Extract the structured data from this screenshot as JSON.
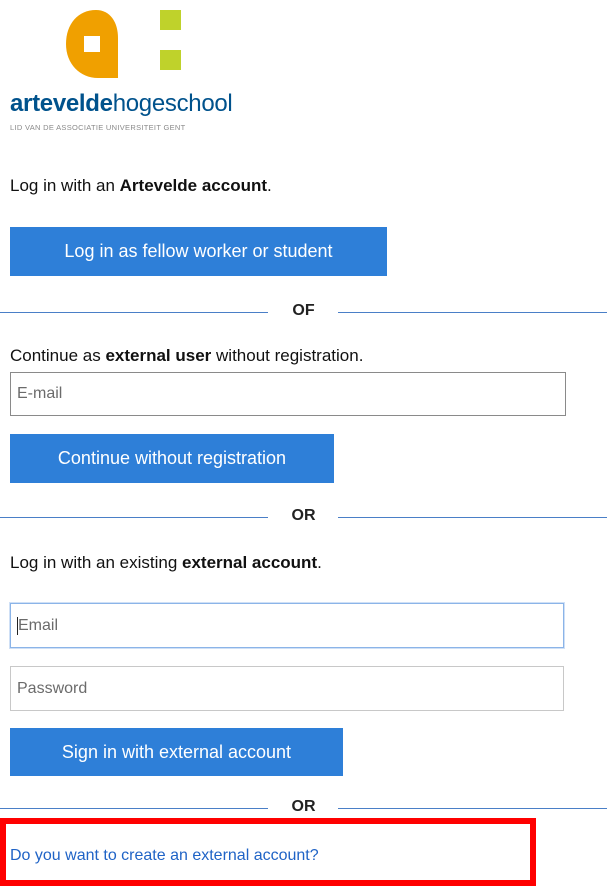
{
  "logo": {
    "word_bold": "artevelde",
    "word_light": "hogeschool",
    "subtitle": "LID VAN DE ASSOCIATIE UNIVERSITEIT GENT",
    "colors": {
      "orange": "#f0a000",
      "lime": "#bfd22b",
      "blue": "#00528c"
    }
  },
  "section_artevelde": {
    "prefix": "Log in with an ",
    "bold": "Artevelde account",
    "suffix": ".",
    "button_label": "Log in as fellow worker or student"
  },
  "divider_1": {
    "label": "OF"
  },
  "section_external_user": {
    "prefix": "Continue as ",
    "bold": "external user",
    "suffix": " without registration.",
    "email_placeholder": "E-mail",
    "button_label": "Continue without registration"
  },
  "divider_2": {
    "label": "OR"
  },
  "section_existing_account": {
    "prefix": "Log in with an existing ",
    "bold": "external account",
    "suffix": ".",
    "email_placeholder": "Email",
    "password_placeholder": "Password",
    "button_label": "Sign in with external account"
  },
  "divider_3": {
    "label": "OR"
  },
  "create_account": {
    "link_label": "Do you want to create an external account?",
    "highlight_color": "#ff0000"
  },
  "colors": {
    "button_bg": "#2e7fd8",
    "divider_line": "#4a7fc7",
    "link": "#1f63c6"
  }
}
